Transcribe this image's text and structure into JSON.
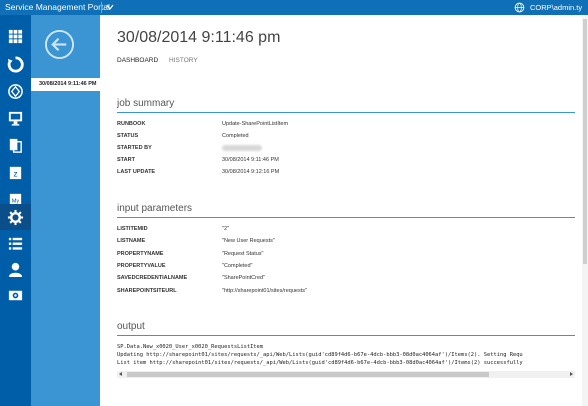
{
  "topbar": {
    "title": "Service Management Portal",
    "user": "CORP\\admin.ty"
  },
  "rail": {
    "icons": [
      "grid-icon",
      "runbook-cycle-icon",
      "network-icon",
      "monitor-icon",
      "document-icon",
      "database-icon",
      "sql-icon",
      "automation-gear-icon",
      "list-icon",
      "user-icon",
      "settings-icon"
    ]
  },
  "col2": {
    "selected_job": "30/08/2014 9:11:46 PM"
  },
  "page": {
    "title": "30/08/2014 9:11:46 pm",
    "tabs": [
      "DASHBOARD",
      "HISTORY"
    ]
  },
  "job_summary": {
    "heading": "job summary",
    "rows": [
      {
        "key": "RUNBOOK",
        "value": "Update-SharePointListItem"
      },
      {
        "key": "STATUS",
        "value": "Completed"
      },
      {
        "key": "STARTED BY",
        "value": ""
      },
      {
        "key": "START",
        "value": "30/08/2014 9:11:46 PM"
      },
      {
        "key": "LAST UPDATE",
        "value": "30/08/2014 9:12:16 PM"
      }
    ]
  },
  "input_parameters": {
    "heading": "input parameters",
    "rows": [
      {
        "key": "LISTITEMID",
        "value": "\"2\""
      },
      {
        "key": "LISTNAME",
        "value": "\"New User Requests\""
      },
      {
        "key": "PROPERTYNAME",
        "value": "\"Request Status\""
      },
      {
        "key": "PROPERTYVALUE",
        "value": "\"Completed\""
      },
      {
        "key": "SAVEDCREDENTIALNAME",
        "value": "\"SharePointCred\""
      },
      {
        "key": "SHAREPOINTSITEURL",
        "value": "\"http://sharepoint01/sites/requests\""
      }
    ]
  },
  "output": {
    "heading": "output",
    "lines": [
      "SP.Data.New_x0020_User_x0020_RequestsListItem",
      "Updating http://sharepoint01/sites/requests/_api/Web/Lists(guid'cd89f4d6-b67e-4dcb-bbb3-08d0ac4064af')/Items(2). Setting Requ",
      "List item http://sharepoint01/sites/requests/_api/Web/Lists(guid'cd89f4d6-b67e-4dcb-bbb3-08d0ac4064af')/Items(2) successfully"
    ]
  },
  "colors": {
    "topbar": "#0f6fb7",
    "rail": "#005da7",
    "secondary_column": "#3b95d3",
    "accent_rule": "#3b95d3"
  }
}
